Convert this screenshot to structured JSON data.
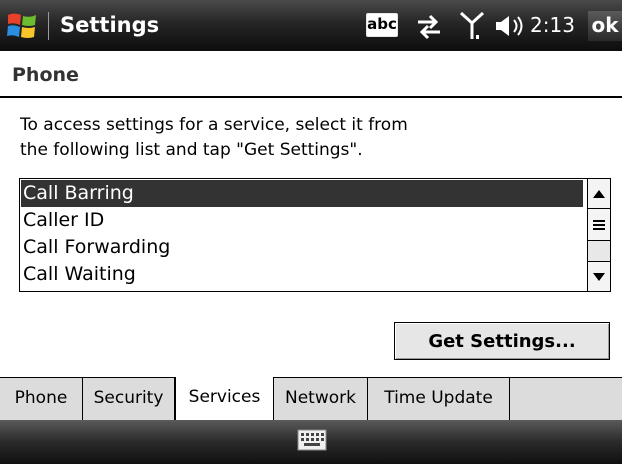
{
  "titlebar": {
    "title": "Settings",
    "abc_label": "abc",
    "clock": "2:13",
    "ok_label": "ok",
    "icons": [
      "windows-start-icon",
      "abc-input-icon",
      "connectivity-icon",
      "signal-icon",
      "volume-icon"
    ]
  },
  "header": {
    "title": "Phone"
  },
  "content": {
    "instructions_line1": "To access settings for a service, select it from",
    "instructions_line2": "the following list and tap \"Get Settings\".",
    "services": [
      "Call Barring",
      "Caller ID",
      "Call Forwarding",
      "Call Waiting"
    ],
    "selected_service": "Call Barring",
    "get_settings_label": "Get Settings..."
  },
  "tabs": [
    {
      "label": "Phone"
    },
    {
      "label": "Security"
    },
    {
      "label": "Services"
    },
    {
      "label": "Network"
    },
    {
      "label": "Time Update"
    }
  ],
  "active_tab": "Services",
  "bottombar": {
    "icons": [
      "keyboard-icon"
    ]
  }
}
